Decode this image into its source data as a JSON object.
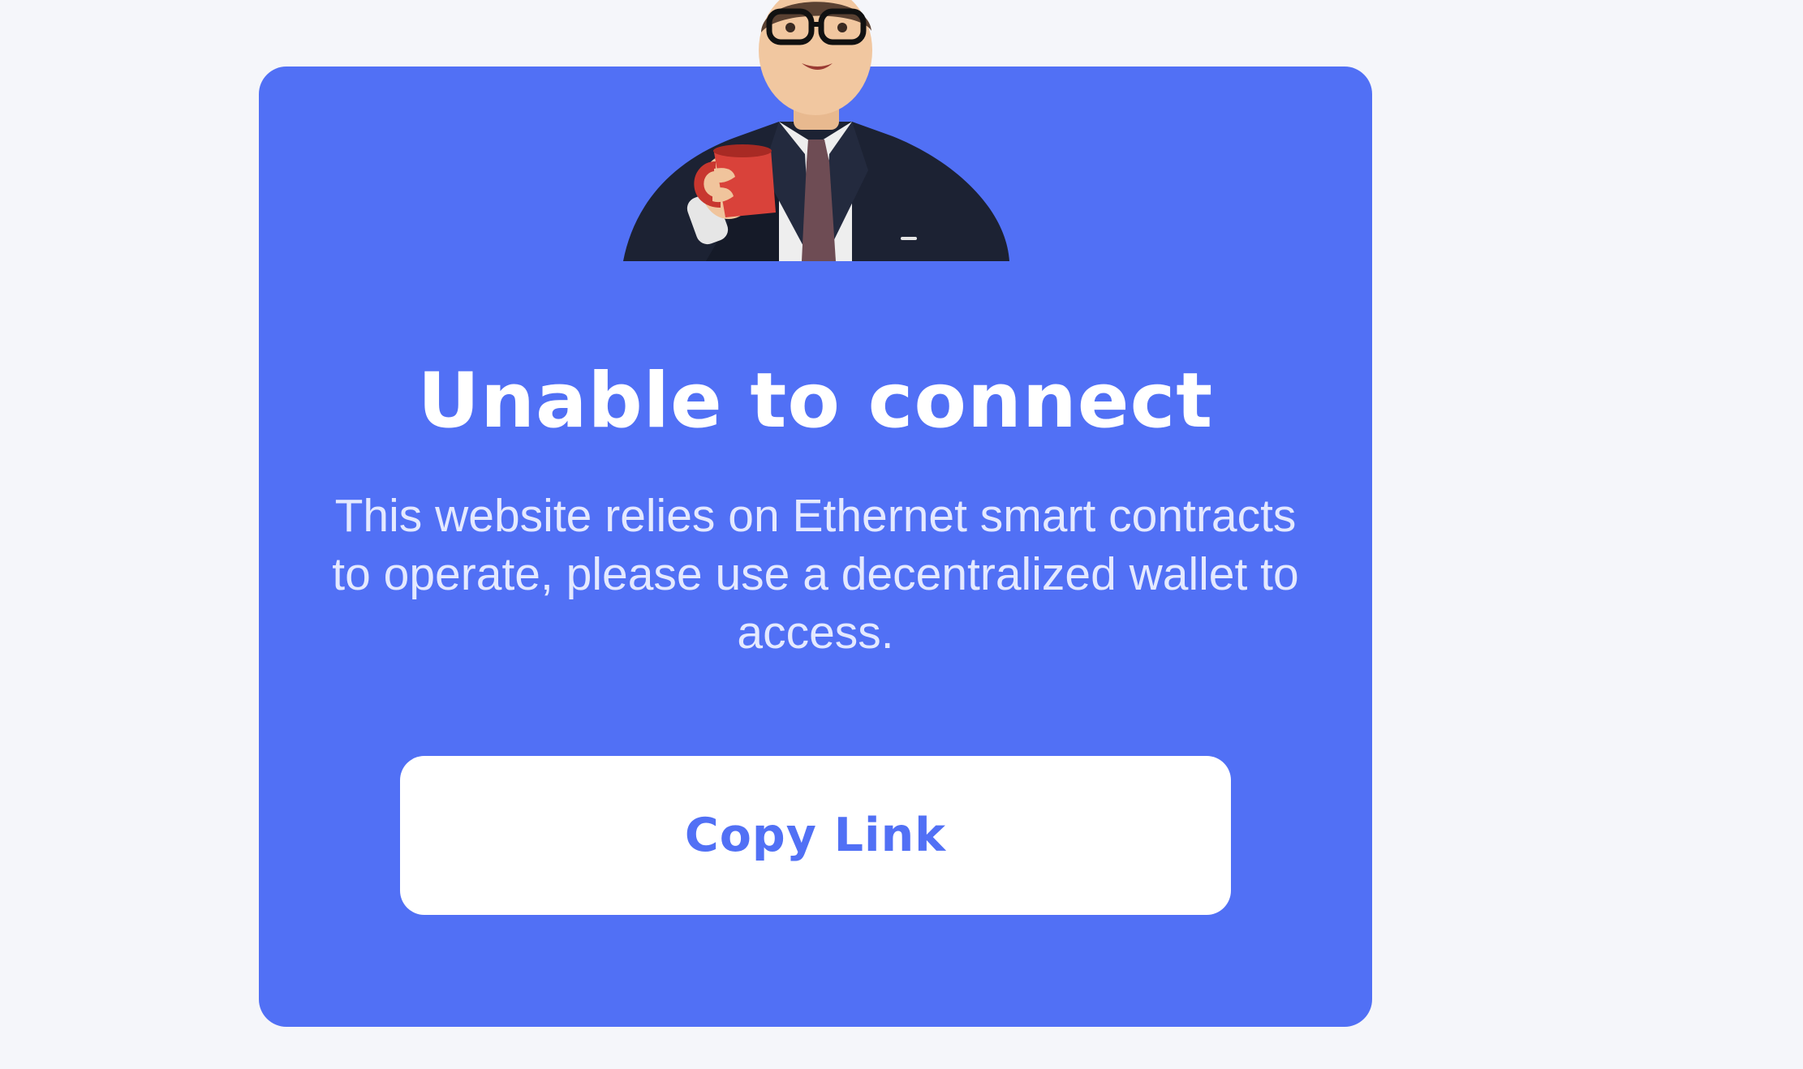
{
  "dialog": {
    "title": "Unable to connect",
    "description": "This website relies on Ethernet smart contracts to operate, please use a decentralized wallet to access.",
    "copy_button_label": "Copy Link"
  },
  "mascot": {
    "icon": "businessman-with-coffee-mug-illustration"
  },
  "colors": {
    "background": "#f5f6fa",
    "card": "#5170f5",
    "button_bg": "#ffffff",
    "button_text": "#5170f5",
    "title_text": "#ffffff",
    "description_text": "#e4e9ff"
  }
}
